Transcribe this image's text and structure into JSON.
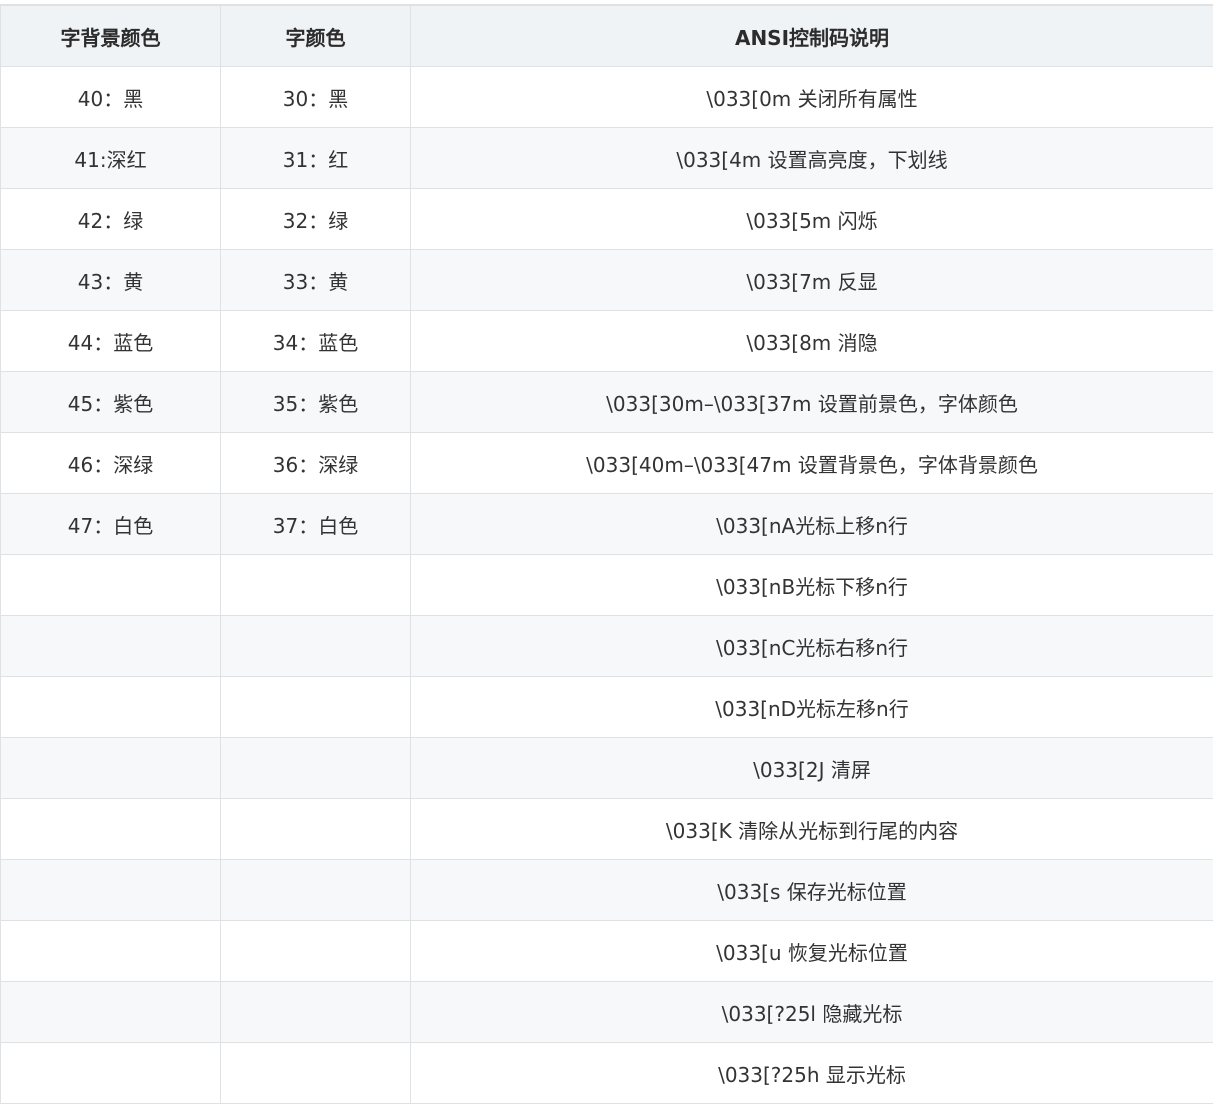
{
  "table": {
    "headers": [
      "字背景颜色",
      "字颜色",
      "ANSI控制码说明"
    ],
    "rows": [
      [
        "40：黑",
        "30：黑",
        "\\033[0m 关闭所有属性"
      ],
      [
        "41:深红",
        "31：红",
        "\\033[4m 设置高亮度，下划线"
      ],
      [
        "42：绿",
        "32：绿",
        "\\033[5m 闪烁"
      ],
      [
        "43：黄",
        "33：黄",
        "\\033[7m 反显"
      ],
      [
        "44：蓝色",
        "34：蓝色",
        "\\033[8m 消隐"
      ],
      [
        "45：紫色",
        "35：紫色",
        "\\033[30m–\\033[37m 设置前景色，字体颜色"
      ],
      [
        "46：深绿",
        "36：深绿",
        "\\033[40m–\\033[47m 设置背景色，字体背景颜色"
      ],
      [
        "47：白色",
        "37：白色",
        "\\033[nA光标上移n行"
      ],
      [
        "",
        "",
        "\\033[nB光标下移n行"
      ],
      [
        "",
        "",
        "\\033[nC光标右移n行"
      ],
      [
        "",
        "",
        "\\033[nD光标左移n行"
      ],
      [
        "",
        "",
        "\\033[2J 清屏"
      ],
      [
        "",
        "",
        "\\033[K 清除从光标到行尾的内容"
      ],
      [
        "",
        "",
        "\\033[s 保存光标位置"
      ],
      [
        "",
        "",
        "\\033[u 恢复光标位置"
      ],
      [
        "",
        "",
        "\\033[?25l 隐藏光标"
      ],
      [
        "",
        "",
        "\\033[?25h 显示光标"
      ]
    ]
  }
}
